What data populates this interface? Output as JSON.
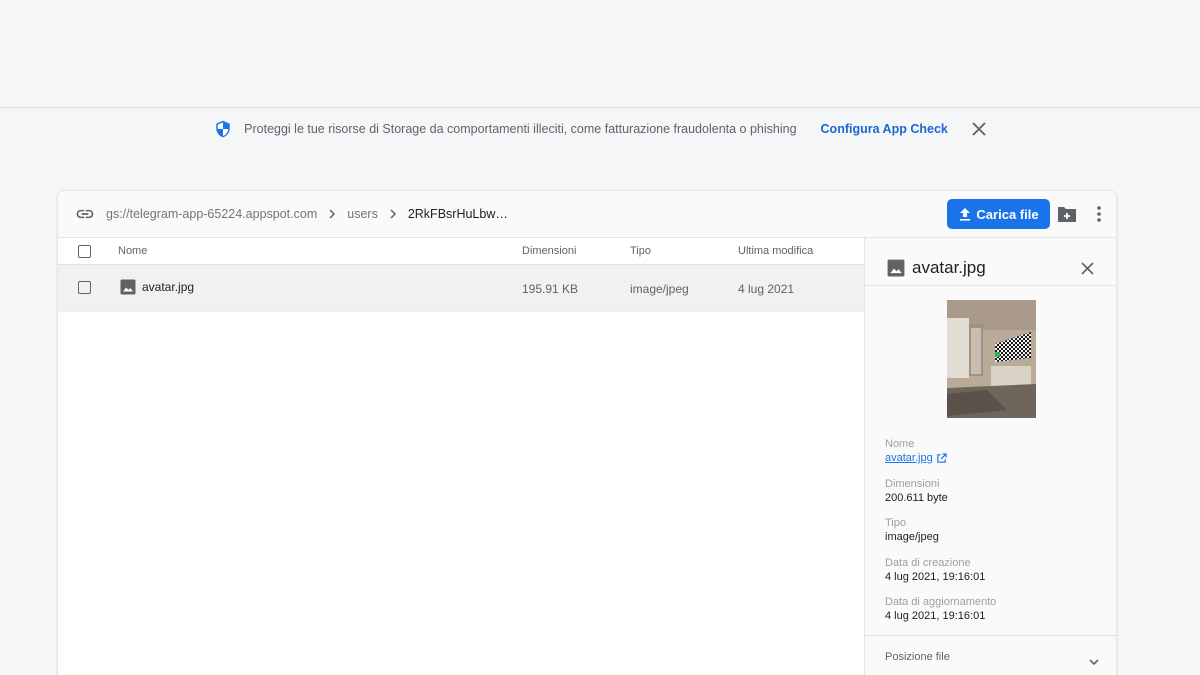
{
  "banner": {
    "message": "Proteggi le tue risorse di Storage da comportamenti illeciti, come fatturazione fraudolenta o phishing",
    "link_label": "Configura App Check",
    "icon": "shield-icon",
    "close_icon": "close-icon"
  },
  "toolbar": {
    "link_icon": "link-icon",
    "breadcrumb": [
      {
        "label": "gs://telegram-app-65224.appspot.com"
      },
      {
        "label": "users"
      },
      {
        "label": "2RkFBsrHuLbw…"
      }
    ],
    "upload_label": "Carica file",
    "upload_icon": "upload-icon",
    "new_folder_icon": "create-folder-icon",
    "more_icon": "more-vert-icon"
  },
  "table": {
    "columns": {
      "name": "Nome",
      "size": "Dimensioni",
      "type": "Tipo",
      "modified": "Ultima modifica"
    },
    "rows": [
      {
        "name": "avatar.jpg",
        "size": "195.91 KB",
        "type": "image/jpeg",
        "modified": "4 lug 2021"
      }
    ]
  },
  "details": {
    "title": "avatar.jpg",
    "properties": {
      "name_label": "Nome",
      "name_value": "avatar.jpg",
      "size_label": "Dimensioni",
      "size_value": "200.611 byte",
      "type_label": "Tipo",
      "type_value": "image/jpeg",
      "created_label": "Data di creazione",
      "created_value": "4 lug 2021, 19:16:01",
      "updated_label": "Data di aggiornamento",
      "updated_value": "4 lug 2021, 19:16:01"
    },
    "file_location_label": "Posizione file"
  },
  "colors": {
    "accent": "#1a73e8",
    "page_background": "#f5f6f8",
    "selected_row": "#f1f1f1"
  }
}
